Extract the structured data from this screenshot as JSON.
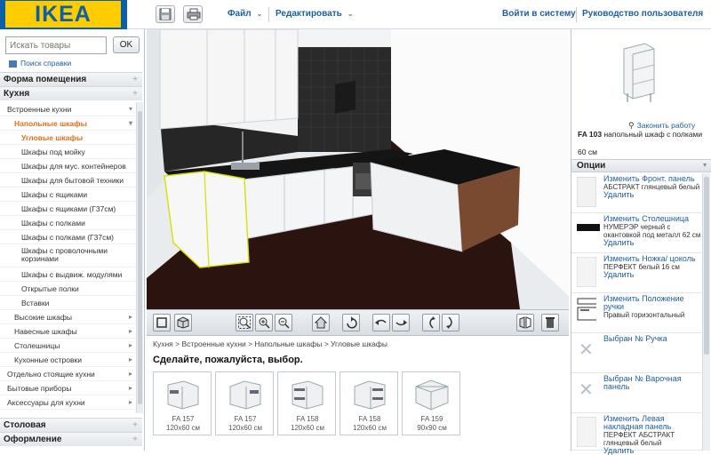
{
  "brand": "IKEA",
  "menu": {
    "file": "Файл",
    "edit": "Редактировать",
    "login": "Войти в систему",
    "guide": "Руководство пользователя"
  },
  "search": {
    "placeholder": "Искать товары",
    "ok": "OK",
    "help": "Поиск справки"
  },
  "left": {
    "room_shape": "Форма помещения",
    "kitchen": "Кухня",
    "tree": [
      "Встроенные кухни",
      "Напольные шкафы",
      "Угловые шкафы",
      "Шкафы под мойку",
      "Шкафы для мус. контейнеров",
      "Шкафы для бытовой техники",
      "Шкафы с ящиками",
      "Шкафы с ящиками (Г37см)",
      "Шкафы с полками",
      "Шкафы с полками (Г37см)",
      "Шкафы с проволочными корзинами",
      "Шкафы с выдвиж. модулями",
      "Открытые полки",
      "Вставки",
      "Высокие шкафы",
      "Навесные шкафы",
      "Столешницы",
      "Кухонные островки",
      "Отдельно стоящие кухни",
      "Бытовые приборы",
      "Аксессуары для кухни"
    ],
    "dining": "Столовая",
    "decor": "Оформление"
  },
  "catalog": {
    "breadcrumb": [
      "Кухня",
      "Встроенные кухни",
      "Напольные шкафы",
      "Угловые шкафы"
    ],
    "prompt": "Сделайте, пожалуйста, выбор.",
    "items": [
      {
        "code": "FA 157",
        "size": "120x60 см"
      },
      {
        "code": "FA 157",
        "size": "120x60 см"
      },
      {
        "code": "FA 158",
        "size": "120x60 см"
      },
      {
        "code": "FA 158",
        "size": "120x60 см"
      },
      {
        "code": "FA 159",
        "size": "90x90 см"
      }
    ]
  },
  "product": {
    "enlarge": "Законить работу",
    "code": "FA 103",
    "name": "напольный шкаф с полками",
    "size": "60 см"
  },
  "options": {
    "title": "Опции",
    "items": [
      {
        "link": "Изменить Фронт. панель",
        "desc": "АБСТРАКТ глянцевый белый",
        "del": "Удалить"
      },
      {
        "link": "Изменить Столешница",
        "desc": "НУМЕРЭР черный с окантовкой под металл 62 см",
        "del": "Удалить"
      },
      {
        "link": "Изменить Ножка/ цоколь",
        "desc": "ПЕРФЕКТ белый 16 см",
        "del": "Удалить"
      },
      {
        "link": "Изменить Положение ручки",
        "desc": "Правый горизонтальный",
        "del": ""
      },
      {
        "link": "Выбран № Ручка",
        "desc": "",
        "del": ""
      },
      {
        "link": "Выбран № Варочная панель",
        "desc": "",
        "del": ""
      },
      {
        "link": "Изменить Левая накладная панель",
        "desc": "ПЕРФЕКТ АБСТРАКТ глянцевый белый",
        "del": "Удалить"
      }
    ]
  },
  "colors": {
    "ikea_blue": "#0a5fa6",
    "ikea_yellow": "#ffcc00",
    "link": "#1f5d9c",
    "active": "#e07020",
    "floor": "#2b1410",
    "tile": "#2a2a2a"
  }
}
